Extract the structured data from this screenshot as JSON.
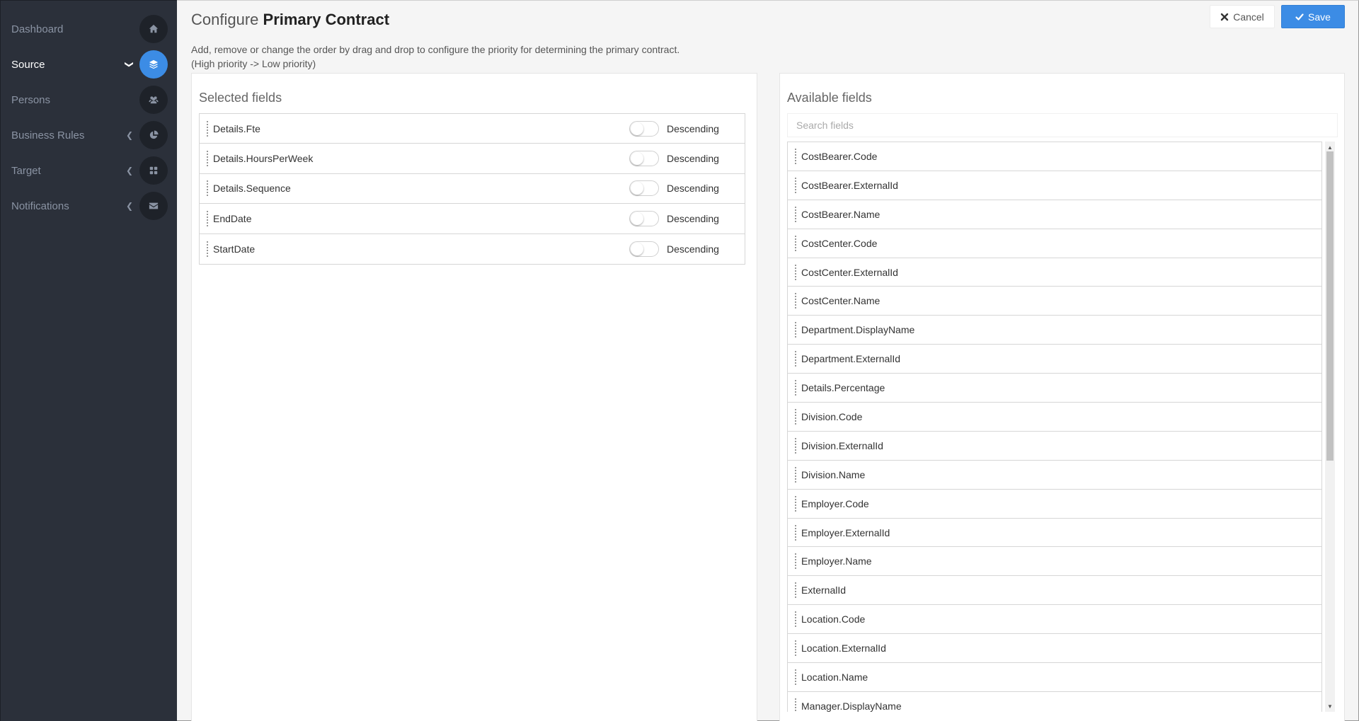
{
  "sidebar": {
    "items": [
      {
        "label": "Dashboard",
        "icon": "home-icon",
        "chevron": ""
      },
      {
        "label": "Source",
        "icon": "layers-icon",
        "chevron": "❯",
        "active": true
      },
      {
        "label": "Persons",
        "icon": "users-icon",
        "chevron": ""
      },
      {
        "label": "Business Rules",
        "icon": "pie-chart-icon",
        "chevron": "❮"
      },
      {
        "label": "Target",
        "icon": "grid-icon",
        "chevron": "❮"
      },
      {
        "label": "Notifications",
        "icon": "envelope-icon",
        "chevron": "❮"
      }
    ]
  },
  "header": {
    "title_prefix": "Configure",
    "title_bold": "Primary Contract",
    "description_line1": "Add, remove or change the order by drag and drop to configure the priority for determining the primary contract.",
    "description_line2": "(High priority -> Low priority)",
    "cancel_label": "Cancel",
    "save_label": "Save"
  },
  "selected": {
    "title": "Selected fields",
    "sort_label": "Descending",
    "rows": [
      "Details.Fte",
      "Details.HoursPerWeek",
      "Details.Sequence",
      "EndDate",
      "StartDate"
    ]
  },
  "available": {
    "title": "Available fields",
    "search_placeholder": "Search fields",
    "rows": [
      "CostBearer.Code",
      "CostBearer.ExternalId",
      "CostBearer.Name",
      "CostCenter.Code",
      "CostCenter.ExternalId",
      "CostCenter.Name",
      "Department.DisplayName",
      "Department.ExternalId",
      "Details.Percentage",
      "Division.Code",
      "Division.ExternalId",
      "Division.Name",
      "Employer.Code",
      "Employer.ExternalId",
      "Employer.Name",
      "ExternalId",
      "Location.Code",
      "Location.ExternalId",
      "Location.Name",
      "Manager.DisplayName"
    ]
  },
  "colors": {
    "accent": "#3c8ce5",
    "sidebar_bg": "#2b303a"
  }
}
